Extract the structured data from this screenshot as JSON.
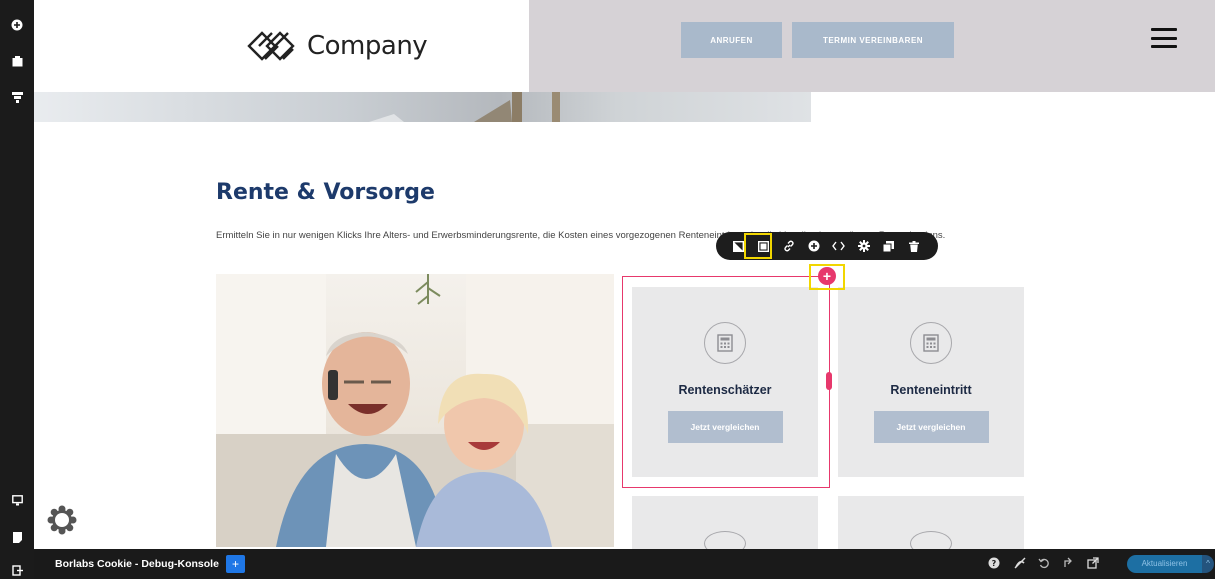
{
  "brand": {
    "name": "Company"
  },
  "header": {
    "call_label": "ANRUFEN",
    "appointment_label": "TERMIN VEREINBAREN"
  },
  "section": {
    "title": "Rente & Vorsorge",
    "text": "Ermitteln Sie in nur wenigen Klicks Ihre Alters- und Erwerbsminderungsrente, die Kosten eines vorgezogenen Renteneintritts oder die Vorteile eines späteren Rentenbeginns."
  },
  "cards": [
    {
      "title": "Rentenschätzer",
      "button": "Jetzt vergleichen",
      "icon": "calculator-icon"
    },
    {
      "title": "Renteneintritt",
      "button": "Jetzt vergleichen",
      "icon": "calculator-icon"
    }
  ],
  "add_button": {
    "label": "+"
  },
  "debug": {
    "title": "Borlabs Cookie - Debug-Konsole",
    "plus": "+",
    "refresh_label": "Aktualisieren",
    "caret": "^"
  },
  "colors": {
    "accent": "#e7386c",
    "highlight": "#f1d600",
    "title": "#1d3a6b",
    "button": "#a9b9cb"
  }
}
